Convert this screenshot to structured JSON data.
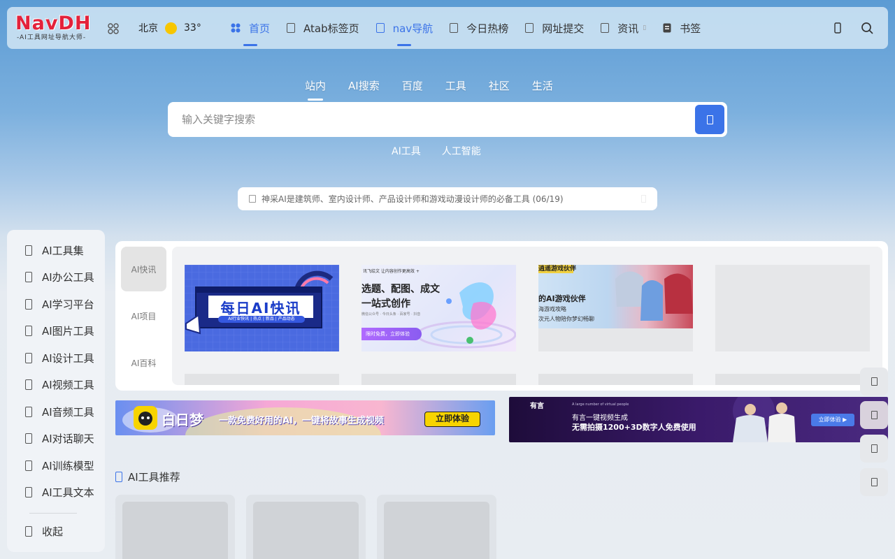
{
  "header": {
    "logo_main": "NavDH",
    "logo_sub": "-AI工具网址导航大师-",
    "city": "北京",
    "temperature": "33°",
    "weather_icon": "sun-icon",
    "nav": [
      {
        "label": "首页",
        "icon": "home-icon",
        "active": true
      },
      {
        "label": "Atab标签页",
        "icon": "tab-icon",
        "active": false
      },
      {
        "label": "nav导航",
        "icon": "nav-icon",
        "active": true
      },
      {
        "label": "今日热榜",
        "icon": "hot-icon",
        "active": false
      },
      {
        "label": "网址提交",
        "icon": "submit-icon",
        "active": false
      },
      {
        "label": "资讯",
        "icon": "news-icon",
        "active": false,
        "dropdown": true
      },
      {
        "label": "书签",
        "icon": "bookmark-icon",
        "active": false
      }
    ]
  },
  "search": {
    "tabs": [
      "站内",
      "AI搜索",
      "百度",
      "工具",
      "社区",
      "生活"
    ],
    "active_tab": "站内",
    "placeholder": "输入关键字搜索",
    "hotwords": [
      "AI工具",
      "人工智能"
    ]
  },
  "notice": {
    "text": "神采AI是建筑师、室内设计师、产品设计师和游戏动漫设计师的必备工具 (06/19)"
  },
  "sidebar": {
    "items": [
      {
        "label": "AI工具集"
      },
      {
        "label": "AI办公工具"
      },
      {
        "label": "AI学习平台"
      },
      {
        "label": "AI图片工具"
      },
      {
        "label": "AI设计工具"
      },
      {
        "label": "AI视频工具"
      },
      {
        "label": "AI音频工具"
      },
      {
        "label": "AI对话聊天"
      },
      {
        "label": "AI训练模型"
      },
      {
        "label": "AI工具文本"
      }
    ],
    "collapse_label": "收起"
  },
  "news": {
    "tabs": [
      "AI快讯",
      "AI项目",
      "AI百科"
    ],
    "active_tab": "AI快讯",
    "thumb1": {
      "title": "每日AI快讯",
      "tags": "AI行业快讯 | 热点 | 新品 | 产品动态"
    },
    "thumb2": {
      "top": "讯飞绘文   让内容创作更高效 +",
      "line1": "选题、配图、成文",
      "line2": "一站式创作",
      "btn": "限时免费，立即体验",
      "sub": "微信公众号 · 今日头条 · 百家号 · 抖音"
    },
    "thumb3": {
      "top": "逍遥游戏伙伴",
      "line1": "的AI游戏伙伴",
      "line2": "海游戏攻略",
      "line3": "次元人物陪你梦幻畅聊"
    }
  },
  "banner1": {
    "brand": "白日梦",
    "slogan": "一款免费好用的AI，一键将故事生成视频",
    "btn": "立即体验"
  },
  "banner2": {
    "brand": "有言",
    "top": "A large number of virtual people",
    "line1": "有言一键视频生成",
    "line2": "无需拍摄1200+3D数字人免费使用",
    "btn": "立即体验 ▶"
  },
  "recommend": {
    "title": "AI工具推荐"
  },
  "colors": {
    "accent": "#3b73e8",
    "logo_red": "#e3223b"
  }
}
